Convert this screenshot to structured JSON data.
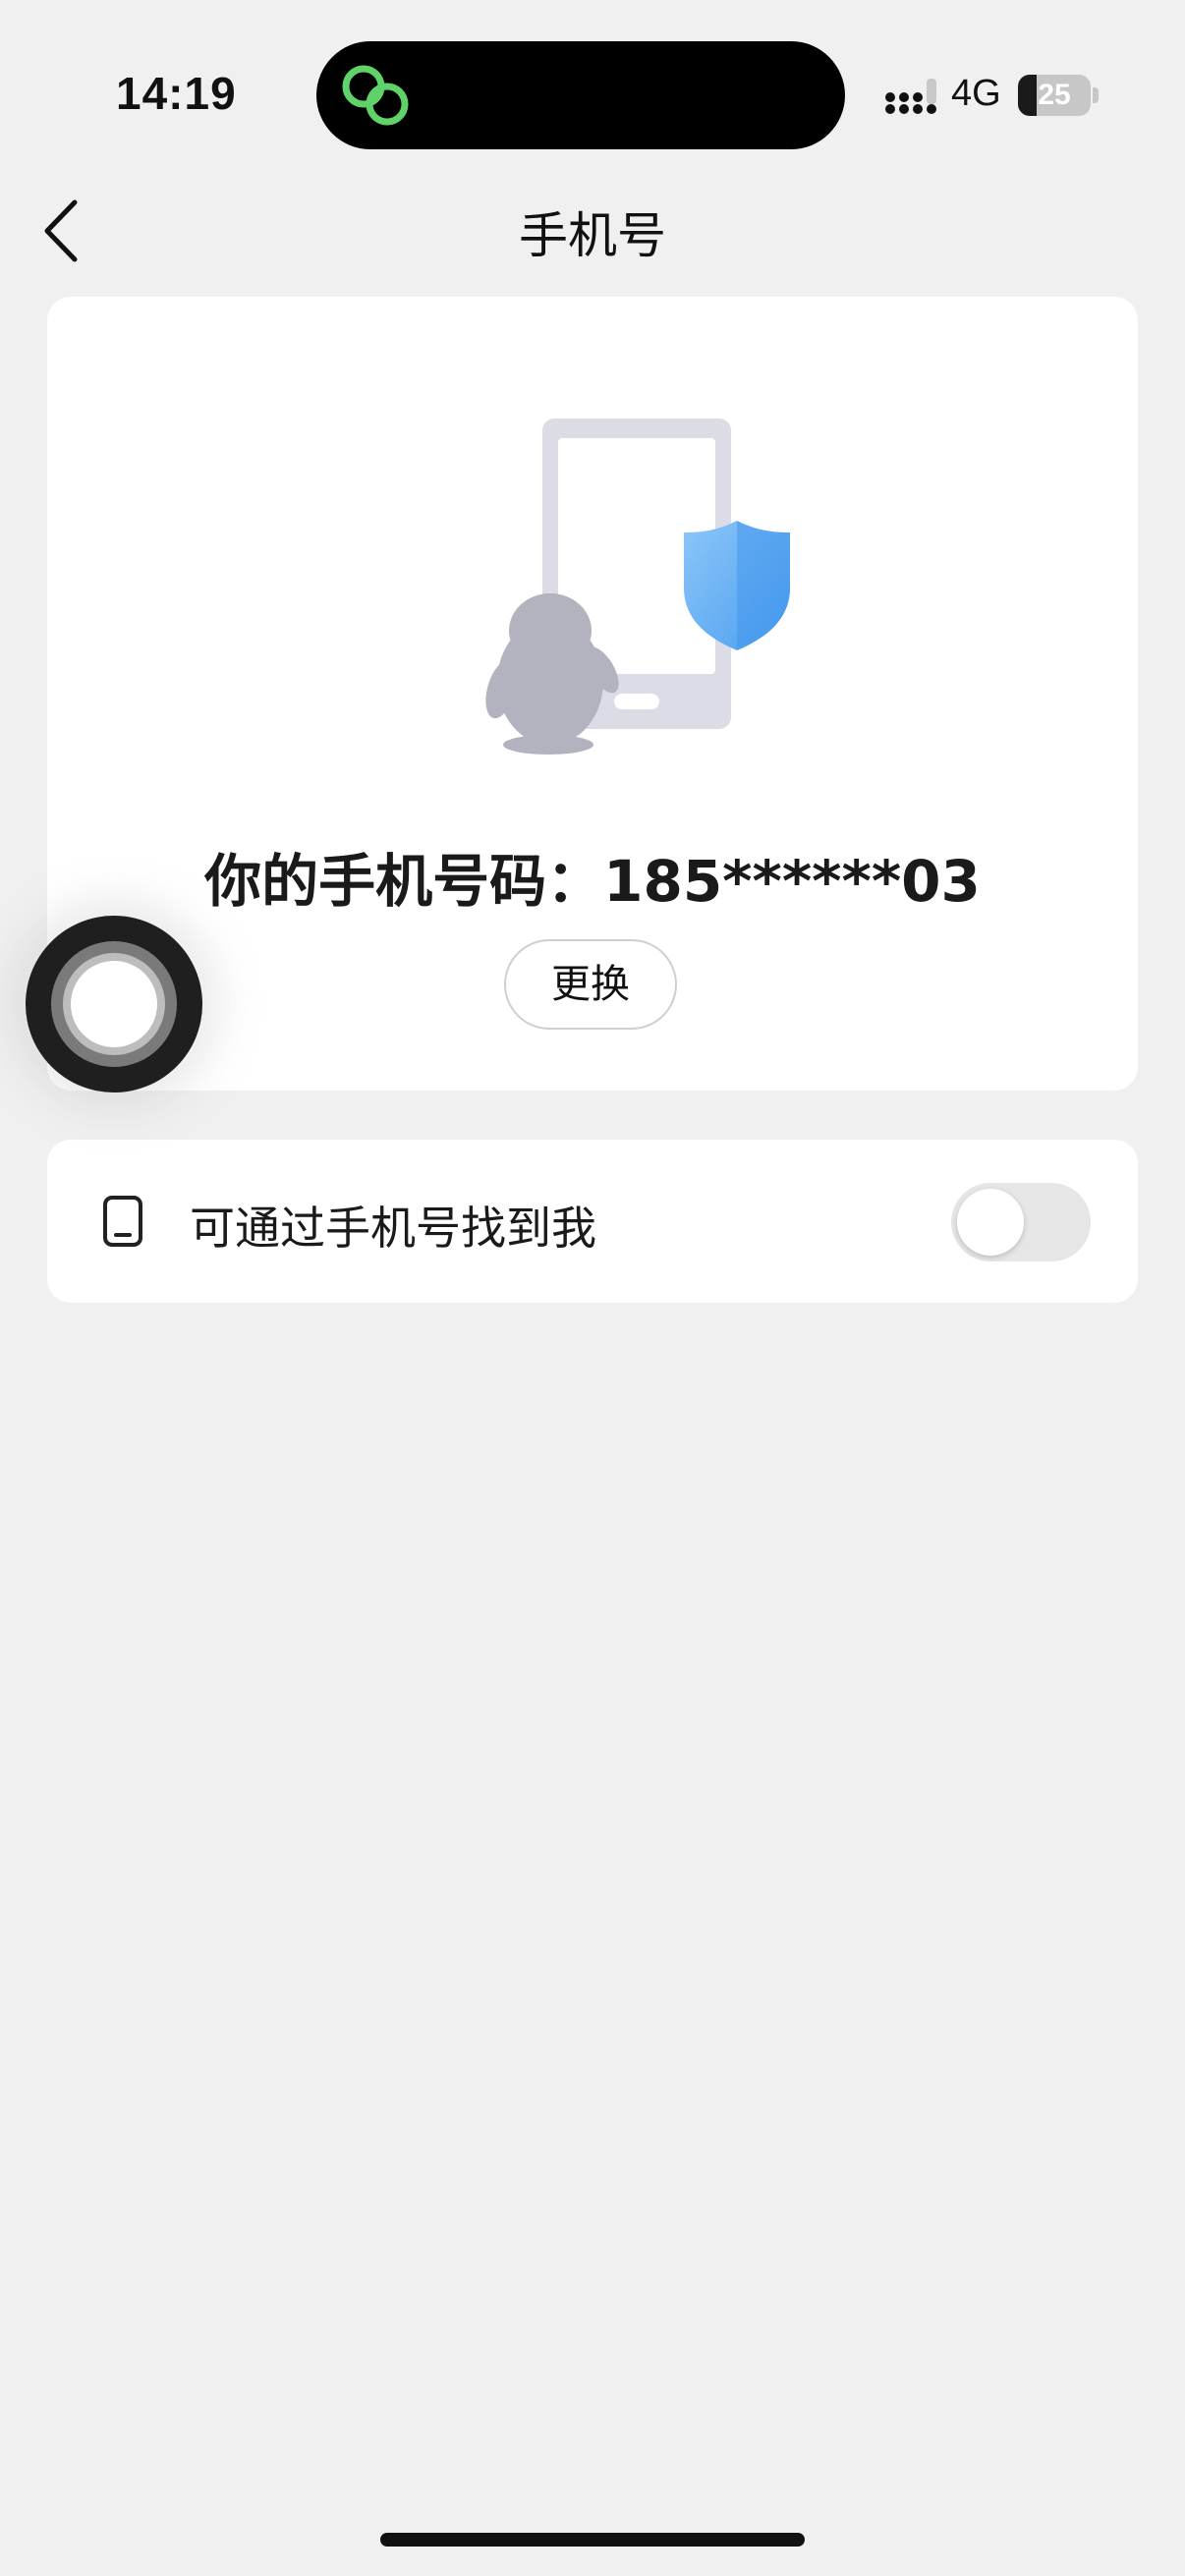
{
  "status_bar": {
    "time": "14:19",
    "network": "4G",
    "battery_level": "25",
    "battery_fraction": 0.25,
    "island_app_icon": "link-rings-icon",
    "island_icon_color": "#5fd36a"
  },
  "nav": {
    "title": "手机号",
    "back_icon": "chevron-left-icon"
  },
  "phone_card": {
    "illustration": "phone-shield-penguin-illustration",
    "phone_number_label": "你的手机号码：185******03",
    "change_button_label": "更换"
  },
  "find_me": {
    "icon": "phone-icon",
    "label": "可通过手机号找到我",
    "toggle_on": false
  },
  "colors": {
    "background": "#f0f0f0",
    "card": "#ffffff",
    "shield": "#5aa8f0",
    "toggle_off": "#e6e6e6"
  }
}
